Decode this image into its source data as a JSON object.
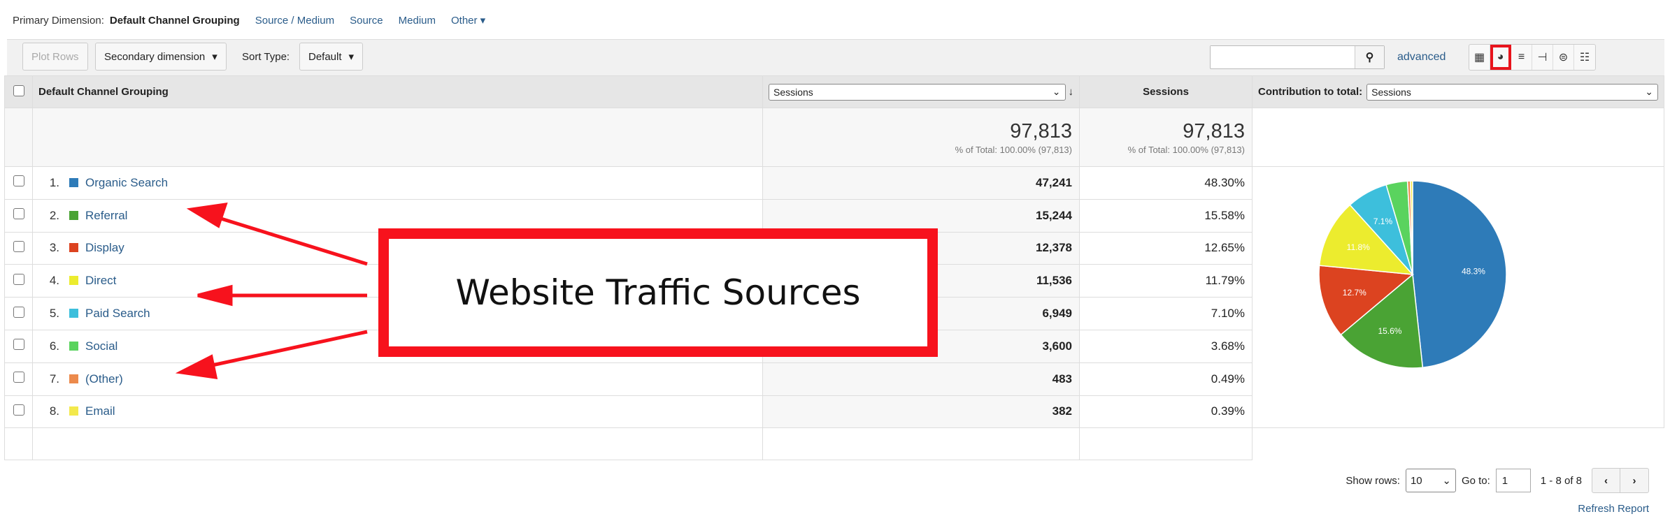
{
  "primary_dimension": {
    "label": "Primary Dimension:",
    "current": "Default Channel Grouping",
    "options": [
      "Source / Medium",
      "Source",
      "Medium",
      "Other ▾"
    ]
  },
  "toolbar": {
    "plot_rows": "Plot Rows",
    "secondary_dimension": "Secondary dimension",
    "sort_type_label": "Sort Type:",
    "sort_type": "Default",
    "search_placeholder": "",
    "advanced": "advanced"
  },
  "table": {
    "header": {
      "dimension": "Default Channel Grouping",
      "metric_select": "Sessions",
      "metric2": "Sessions",
      "contribution_label": "Contribution to total:",
      "contribution_select": "Sessions"
    },
    "totals": {
      "sessions": "97,813",
      "sessions_sub": "% of Total: 100.00% (97,813)",
      "sessions2": "97,813",
      "sessions2_sub": "% of Total: 100.00% (97,813)"
    },
    "rows": [
      {
        "rank": "1.",
        "name": "Organic Search",
        "sessions": "47,241",
        "pct": "48.30%",
        "color": "#2e7bb8"
      },
      {
        "rank": "2.",
        "name": "Referral",
        "sessions": "15,244",
        "pct": "15.58%",
        "color": "#4aa334"
      },
      {
        "rank": "3.",
        "name": "Display",
        "sessions": "12,378",
        "pct": "12.65%",
        "color": "#dc4320"
      },
      {
        "rank": "4.",
        "name": "Direct",
        "sessions": "11,536",
        "pct": "11.79%",
        "color": "#ecec2e"
      },
      {
        "rank": "5.",
        "name": "Paid Search",
        "sessions": "6,949",
        "pct": "7.10%",
        "color": "#3dbfdc"
      },
      {
        "rank": "6.",
        "name": "Social",
        "sessions": "3,600",
        "pct": "3.68%",
        "color": "#5ad35e"
      },
      {
        "rank": "7.",
        "name": "(Other)",
        "sessions": "483",
        "pct": "0.49%",
        "color": "#ec8a4c"
      },
      {
        "rank": "8.",
        "name": "Email",
        "sessions": "382",
        "pct": "0.39%",
        "color": "#f3e94c"
      }
    ]
  },
  "chart_data": {
    "type": "pie",
    "categories": [
      "Organic Search",
      "Referral",
      "Display",
      "Direct",
      "Paid Search",
      "Social",
      "(Other)",
      "Email"
    ],
    "values": [
      47241,
      15244,
      12378,
      11536,
      6949,
      3600,
      483,
      382
    ],
    "labels": [
      "48.3%",
      "15.6%",
      "12.7%",
      "11.8%",
      "7.1%",
      "",
      "",
      ""
    ],
    "colors": [
      "#2e7bb8",
      "#4aa334",
      "#dc4320",
      "#ecec2e",
      "#3dbfdc",
      "#5ad35e",
      "#ec8a4c",
      "#f3e94c"
    ]
  },
  "footer": {
    "show_rows_label": "Show rows:",
    "show_rows": "10",
    "goto_label": "Go to:",
    "goto": "1",
    "range": "1 - 8 of 8",
    "prev": "‹",
    "next": "›",
    "refresh": "Refresh Report"
  },
  "callout": {
    "text": "Website Traffic Sources"
  }
}
